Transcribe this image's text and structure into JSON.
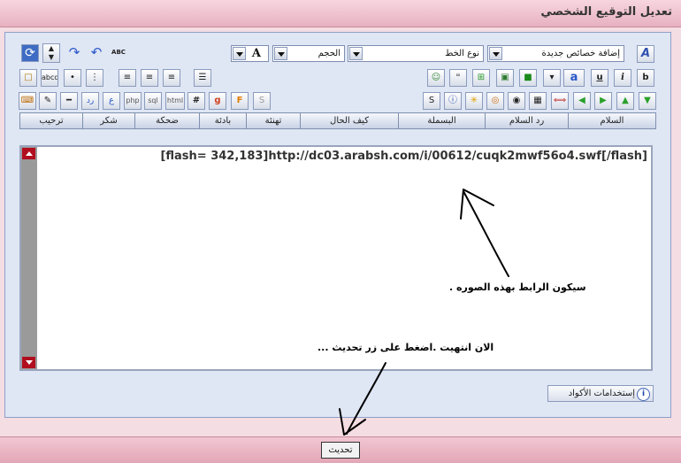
{
  "page": {
    "title": "تعديل التوقيع الشخصي"
  },
  "toolbar": {
    "new_props_select": "إضافة خصائص جديدة",
    "font_type_select": "نوع الخط",
    "size_select": "الحجم",
    "font_color_label": "A",
    "spellcheck_label": "ABC",
    "row2_icons": {
      "b": "b",
      "i": "i",
      "u": "u",
      "abcd": "abcd",
      "a": "a"
    },
    "row3_icons": {
      "s": "S",
      "hash": "#",
      "html": "html",
      "sql": "sql",
      "php": "php",
      "ain": "ع",
      "ra": "رد",
      "strike": "S",
      "flash": "F",
      "google": "g"
    }
  },
  "tabs": [
    "السلام",
    "رد السلام",
    "البسملة",
    "كيف الحال",
    "تهنئة",
    "بادئة",
    "ضحكة",
    "شكر",
    "ترحيب"
  ],
  "editor": {
    "content": "[flash= 342,183]http://dc03.arabsh.com/i/00612/cuqk2mwf56o4.swf[/flash]"
  },
  "help_button": {
    "label": "إستخدامات الأكواد",
    "icon": "i"
  },
  "annotations": {
    "link_note": "سيكون الرابط بهذه الصوره .",
    "finish_note": "الان انتهيت .اضغط على زر تحديث ..."
  },
  "submit_button": {
    "label": "تحديث"
  }
}
